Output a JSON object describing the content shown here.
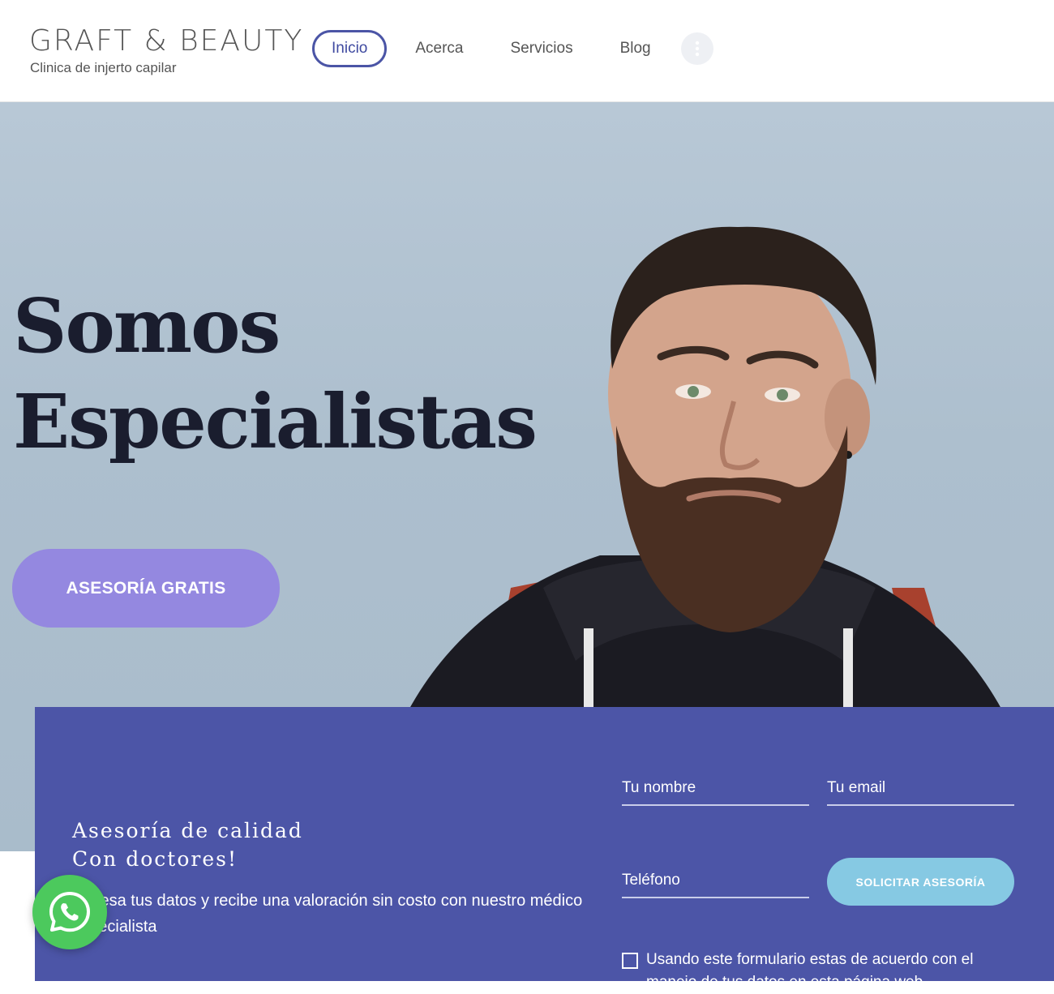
{
  "brand": {
    "title": "GRAFT & BEAUTY",
    "subtitle": "Clinica de injerto capilar"
  },
  "nav": {
    "items": [
      {
        "label": "Inicio",
        "active": true
      },
      {
        "label": "Acerca",
        "active": false
      },
      {
        "label": "Servicios",
        "active": false
      },
      {
        "label": "Blog",
        "active": false
      }
    ],
    "more_icon": "more-vertical-icon"
  },
  "hero": {
    "title_line1": "Somos",
    "title_line2": "Especialistas",
    "cta_label": "ASESORÍA GRATIS",
    "image": "bearded-man-portrait"
  },
  "panel": {
    "heading_line1": "Asesoría de calidad",
    "heading_line2": "Con doctores!",
    "text": "Ingresa tus datos y recibe una valoración sin costo con nuestro médico especialista",
    "fields": {
      "name_placeholder": "Tu nombre",
      "email_placeholder": "Tu email",
      "phone_placeholder": "Teléfono"
    },
    "submit_label": "SOLICITAR ASESORÍA",
    "consent_text": "Usando este formulario estas de acuerdo con el manejo de tus datos en esta página web."
  },
  "colors": {
    "accent": "#4c55a7",
    "cta": "#9488e0",
    "submit": "#86c9e3",
    "whatsapp": "#4cc95d"
  },
  "floating": {
    "whatsapp_icon": "whatsapp-icon"
  }
}
